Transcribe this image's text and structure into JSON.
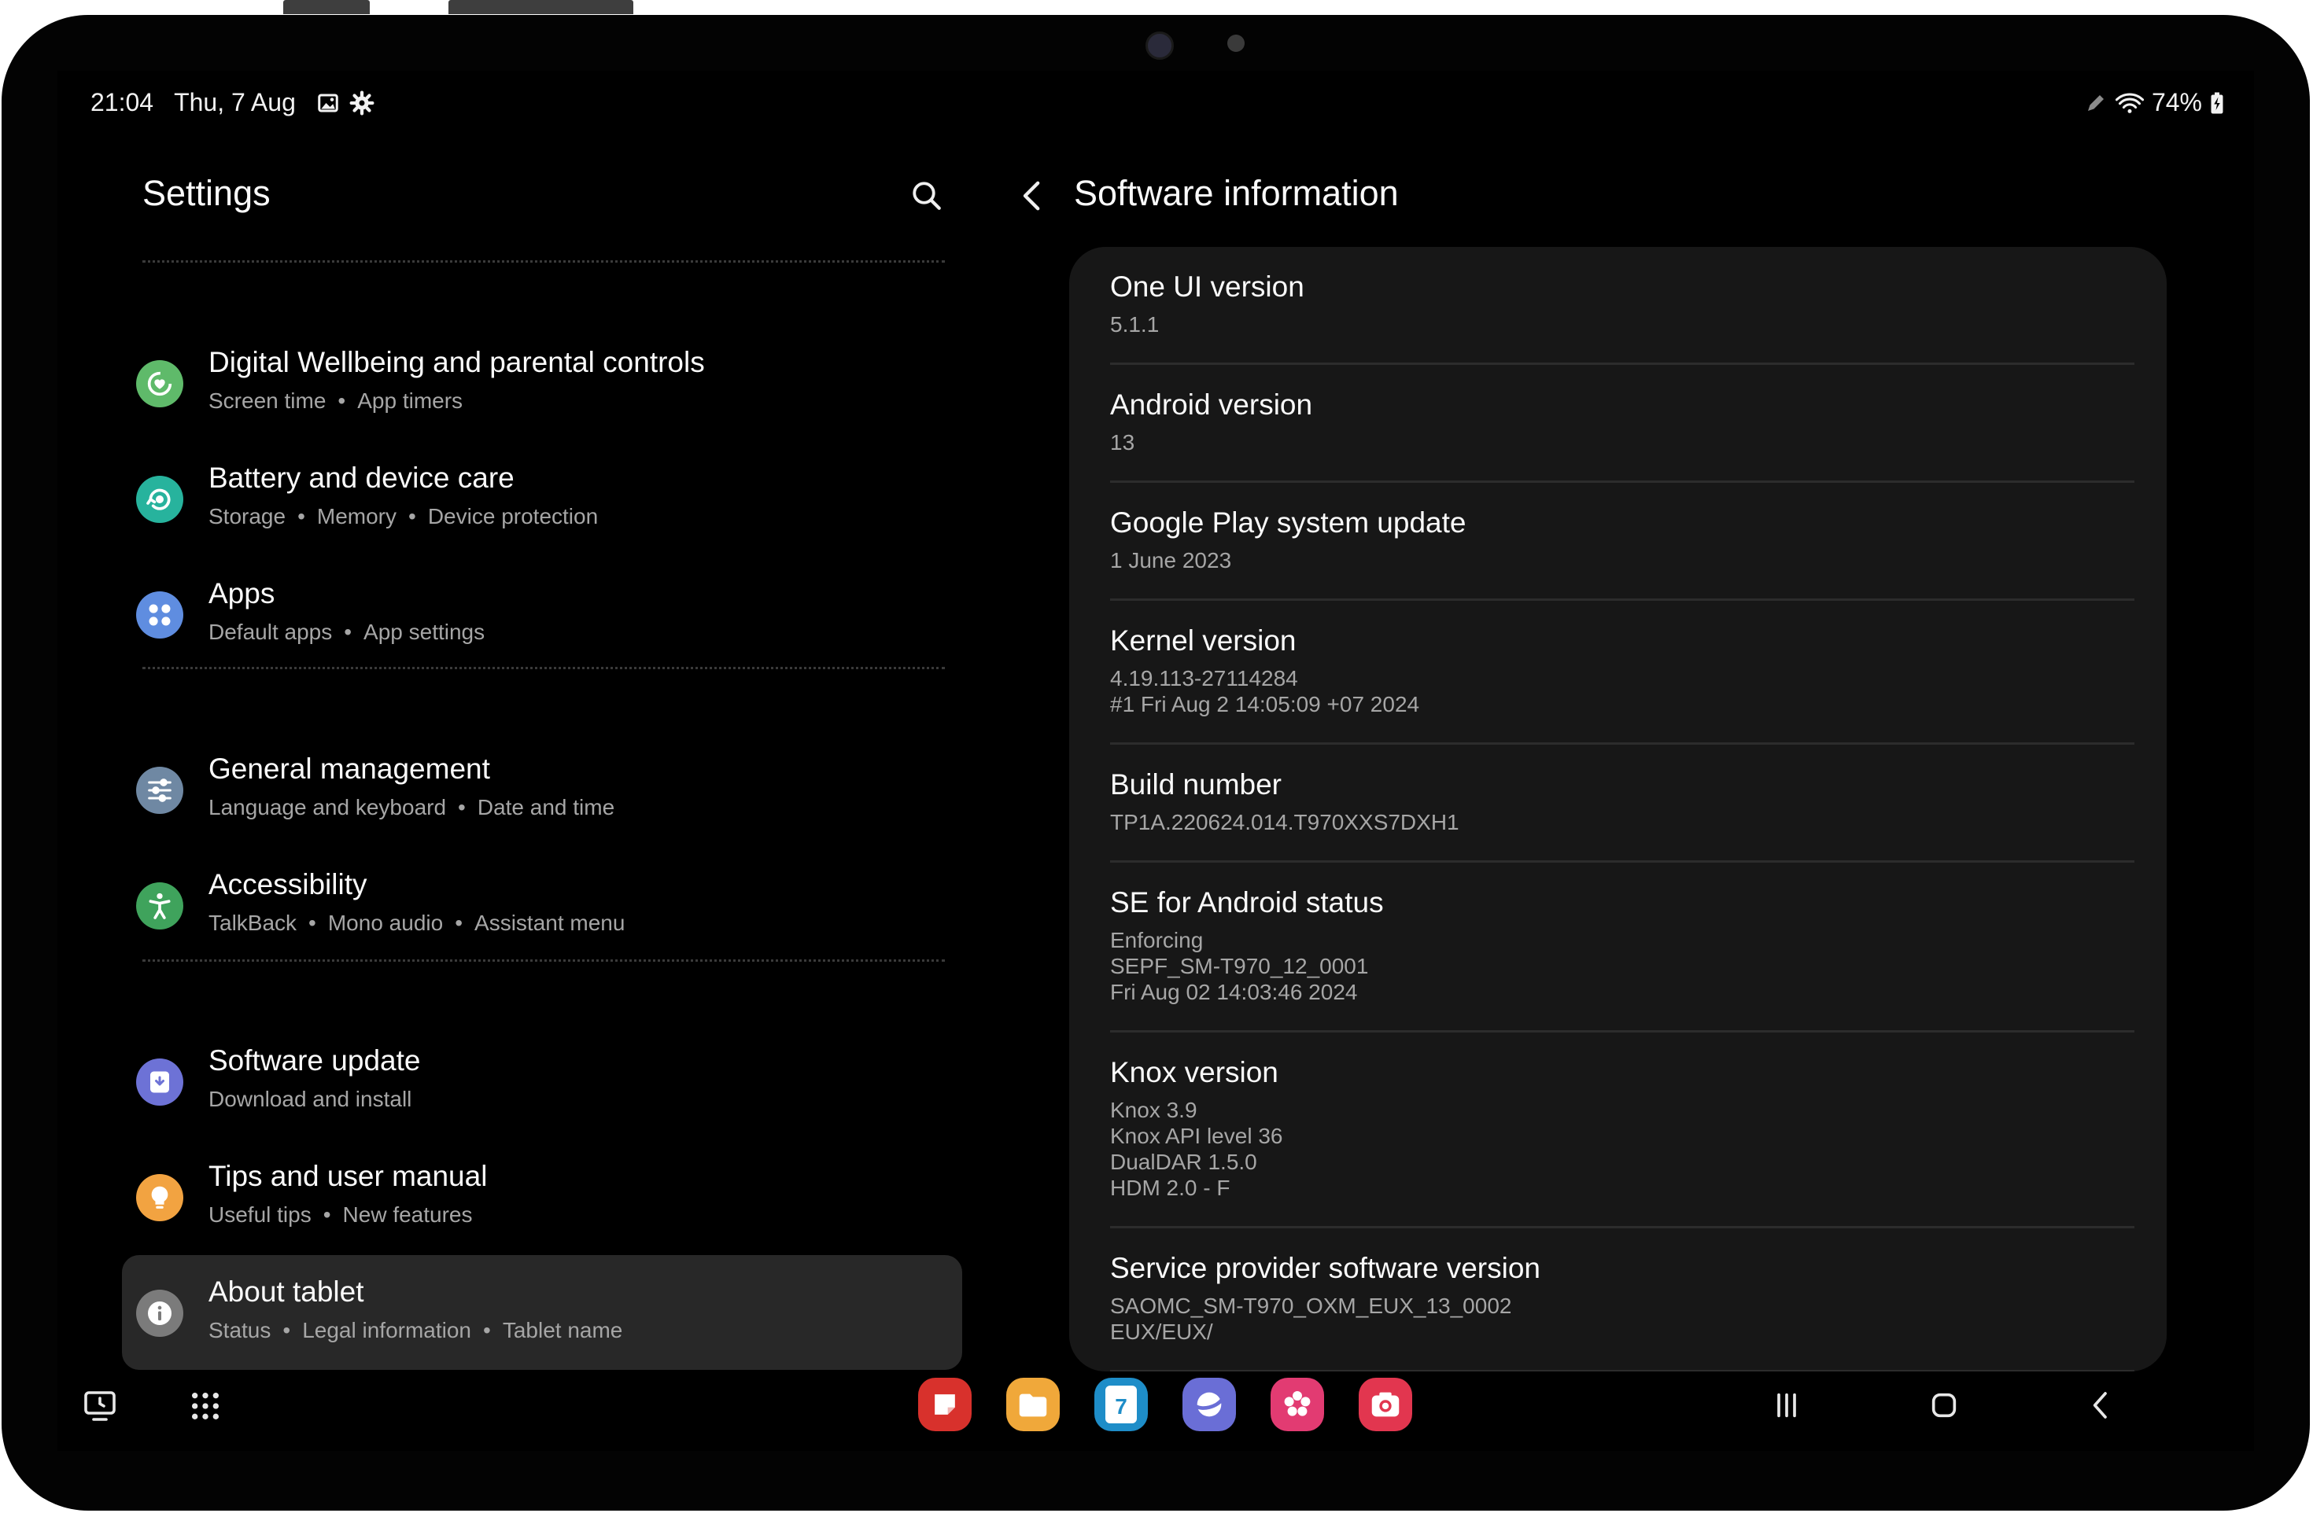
{
  "status_bar": {
    "time": "21:04",
    "date": "Thu, 7 Aug",
    "battery": "74%"
  },
  "settings": {
    "title": "Settings",
    "items": [
      {
        "title": "Digital Wellbeing and parental controls",
        "subs": [
          "Screen time",
          "App timers"
        ],
        "icon": "wellbeing-icon",
        "color": "#5fba6a"
      },
      {
        "title": "Battery and device care",
        "subs": [
          "Storage",
          "Memory",
          "Device protection"
        ],
        "icon": "device-care-icon",
        "color": "#27b39d"
      },
      {
        "title": "Apps",
        "subs": [
          "Default apps",
          "App settings"
        ],
        "icon": "apps-icon",
        "color": "#5f8de0"
      },
      {
        "title": "General management",
        "subs": [
          "Language and keyboard",
          "Date and time"
        ],
        "icon": "sliders-icon",
        "color": "#6f88a3"
      },
      {
        "title": "Accessibility",
        "subs": [
          "TalkBack",
          "Mono audio",
          "Assistant menu"
        ],
        "icon": "accessibility-icon",
        "color": "#3fa35c"
      },
      {
        "title": "Software update",
        "subs": [
          "Download and install"
        ],
        "icon": "software-update-icon",
        "color": "#6d72d6"
      },
      {
        "title": "Tips and user manual",
        "subs": [
          "Useful tips",
          "New features"
        ],
        "icon": "tips-icon",
        "color": "#f2a341"
      },
      {
        "title": "About tablet",
        "subs": [
          "Status",
          "Legal information",
          "Tablet name"
        ],
        "icon": "info-icon",
        "color": "#7b7b7b",
        "selected": true
      }
    ]
  },
  "software_info": {
    "title": "Software information",
    "rows": [
      {
        "title": "One UI version",
        "values": [
          "5.1.1"
        ]
      },
      {
        "title": "Android version",
        "values": [
          "13"
        ]
      },
      {
        "title": "Google Play system update",
        "values": [
          "1 June 2023"
        ]
      },
      {
        "title": "Kernel version",
        "values": [
          "4.19.113-27114284",
          "#1 Fri Aug 2 14:05:09 +07 2024"
        ]
      },
      {
        "title": "Build number",
        "values": [
          "TP1A.220624.014.T970XXS7DXH1"
        ]
      },
      {
        "title": "SE for Android status",
        "values": [
          "Enforcing",
          "SEPF_SM-T970_12_0001",
          "Fri Aug 02 14:03:46 2024"
        ]
      },
      {
        "title": "Knox version",
        "values": [
          "Knox 3.9",
          "Knox API level 36",
          "DualDAR 1.5.0",
          "HDM 2.0 - F"
        ]
      },
      {
        "title": "Service provider software version",
        "values": [
          "SAOMC_SM-T970_OXM_EUX_13_0002",
          "EUX/EUX/"
        ]
      }
    ]
  },
  "taskbar": {
    "apps": [
      {
        "name": "notes-app-icon",
        "color": "#d8312c"
      },
      {
        "name": "my-files-app-icon",
        "color": "#f0a83a"
      },
      {
        "name": "calendar-app-icon",
        "color": "#1e8dc8",
        "label": "7"
      },
      {
        "name": "internet-app-icon",
        "color": "#6a6ed6"
      },
      {
        "name": "gallery-app-icon",
        "color": "#e23b72"
      },
      {
        "name": "camera-app-icon",
        "color": "#e2364f"
      }
    ]
  }
}
